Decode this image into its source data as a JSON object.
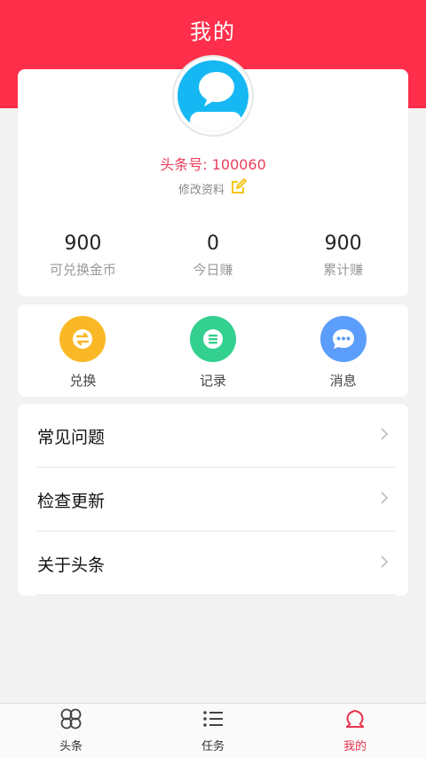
{
  "header": {
    "title": "我的"
  },
  "profile": {
    "user_id_label": "头条号:",
    "user_id_value": "100060",
    "edit_label": "修改资料"
  },
  "stats": [
    {
      "value": "900",
      "label": "可兑换金币"
    },
    {
      "value": "0",
      "label": "今日赚"
    },
    {
      "value": "900",
      "label": "累计赚"
    }
  ],
  "actions": [
    {
      "label": "兑换",
      "icon": "exchange-icon",
      "color": "#fbb826"
    },
    {
      "label": "记录",
      "icon": "list-icon",
      "color": "#33d08f"
    },
    {
      "label": "消息",
      "icon": "chat-icon",
      "color": "#5b9dfa"
    }
  ],
  "menu": [
    {
      "label": "常见问题"
    },
    {
      "label": "检查更新"
    },
    {
      "label": "关于头条"
    }
  ],
  "tabbar": [
    {
      "label": "头条",
      "icon": "clover-icon",
      "active": false
    },
    {
      "label": "任务",
      "icon": "list-bullets-icon",
      "active": false
    },
    {
      "label": "我的",
      "icon": "person-icon",
      "active": true
    }
  ],
  "colors": {
    "brand_red": "#ff2f4b",
    "active_tab": "#e8344e",
    "edit_icon": "#f5c518"
  }
}
